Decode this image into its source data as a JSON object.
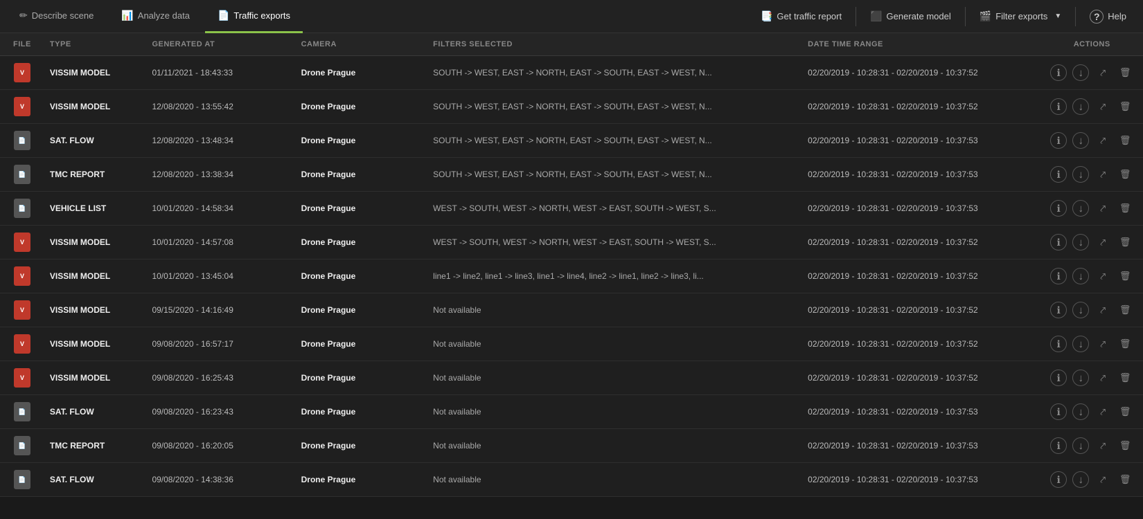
{
  "nav": {
    "tabs": [
      {
        "id": "describe",
        "label": "Describe scene",
        "icon": "pencil",
        "active": false
      },
      {
        "id": "analyze",
        "label": "Analyze data",
        "icon": "chart",
        "active": false
      },
      {
        "id": "traffic-exports",
        "label": "Traffic exports",
        "icon": "export",
        "active": true
      }
    ],
    "actions": [
      {
        "id": "get-traffic",
        "label": "Get traffic report",
        "icon": "traffic"
      },
      {
        "id": "generate-model",
        "label": "Generate model",
        "icon": "model"
      },
      {
        "id": "filter-exports",
        "label": "Filter exports",
        "icon": "filter",
        "dropdown": true
      },
      {
        "id": "help",
        "label": "Help",
        "icon": "help"
      }
    ]
  },
  "table": {
    "columns": [
      {
        "id": "file",
        "label": "FILE"
      },
      {
        "id": "type",
        "label": "TYPE"
      },
      {
        "id": "generated_at",
        "label": "GENERATED AT"
      },
      {
        "id": "camera",
        "label": "CAMERA"
      },
      {
        "id": "filters",
        "label": "FILTERS SELECTED"
      },
      {
        "id": "dtr",
        "label": "DATE TIME RANGE"
      },
      {
        "id": "actions",
        "label": "ACTIONS"
      }
    ],
    "rows": [
      {
        "file_type": "vissim",
        "type": "VISSIM MODEL",
        "generated_at": "01/11/2021 - 18:43:33",
        "camera": "Drone Prague",
        "filters": "SOUTH -> WEST, EAST -> NORTH, EAST -> SOUTH, EAST -> WEST, N...",
        "dtr": "02/20/2019 - 10:28:31 - 02/20/2019 - 10:37:52"
      },
      {
        "file_type": "vissim",
        "type": "VISSIM MODEL",
        "generated_at": "12/08/2020 - 13:55:42",
        "camera": "Drone Prague",
        "filters": "SOUTH -> WEST, EAST -> NORTH, EAST -> SOUTH, EAST -> WEST, N...",
        "dtr": "02/20/2019 - 10:28:31 - 02/20/2019 - 10:37:52"
      },
      {
        "file_type": "sat",
        "type": "SAT. FLOW",
        "generated_at": "12/08/2020 - 13:48:34",
        "camera": "Drone Prague",
        "filters": "SOUTH -> WEST, EAST -> NORTH, EAST -> SOUTH, EAST -> WEST, N...",
        "dtr": "02/20/2019 - 10:28:31 - 02/20/2019 - 10:37:53"
      },
      {
        "file_type": "tmc",
        "type": "TMC REPORT",
        "generated_at": "12/08/2020 - 13:38:34",
        "camera": "Drone Prague",
        "filters": "SOUTH -> WEST, EAST -> NORTH, EAST -> SOUTH, EAST -> WEST, N...",
        "dtr": "02/20/2019 - 10:28:31 - 02/20/2019 - 10:37:53"
      },
      {
        "file_type": "veh",
        "type": "VEHICLE LIST",
        "generated_at": "10/01/2020 - 14:58:34",
        "camera": "Drone Prague",
        "filters": "WEST -> SOUTH, WEST -> NORTH, WEST -> EAST, SOUTH -> WEST, S...",
        "dtr": "02/20/2019 - 10:28:31 - 02/20/2019 - 10:37:53"
      },
      {
        "file_type": "vissim",
        "type": "VISSIM MODEL",
        "generated_at": "10/01/2020 - 14:57:08",
        "camera": "Drone Prague",
        "filters": "WEST -> SOUTH, WEST -> NORTH, WEST -> EAST, SOUTH -> WEST, S...",
        "dtr": "02/20/2019 - 10:28:31 - 02/20/2019 - 10:37:52"
      },
      {
        "file_type": "vissim",
        "type": "VISSIM MODEL",
        "generated_at": "10/01/2020 - 13:45:04",
        "camera": "Drone Prague",
        "filters": "line1 -> line2, line1 -> line3, line1 -> line4, line2 -> line1, line2 -> line3, li...",
        "dtr": "02/20/2019 - 10:28:31 - 02/20/2019 - 10:37:52"
      },
      {
        "file_type": "vissim",
        "type": "VISSIM MODEL",
        "generated_at": "09/15/2020 - 14:16:49",
        "camera": "Drone Prague",
        "filters": "Not available",
        "dtr": "02/20/2019 - 10:28:31 - 02/20/2019 - 10:37:52"
      },
      {
        "file_type": "vissim",
        "type": "VISSIM MODEL",
        "generated_at": "09/08/2020 - 16:57:17",
        "camera": "Drone Prague",
        "filters": "Not available",
        "dtr": "02/20/2019 - 10:28:31 - 02/20/2019 - 10:37:52"
      },
      {
        "file_type": "vissim",
        "type": "VISSIM MODEL",
        "generated_at": "09/08/2020 - 16:25:43",
        "camera": "Drone Prague",
        "filters": "Not available",
        "dtr": "02/20/2019 - 10:28:31 - 02/20/2019 - 10:37:52"
      },
      {
        "file_type": "sat",
        "type": "SAT. FLOW",
        "generated_at": "09/08/2020 - 16:23:43",
        "camera": "Drone Prague",
        "filters": "Not available",
        "dtr": "02/20/2019 - 10:28:31 - 02/20/2019 - 10:37:53"
      },
      {
        "file_type": "tmc",
        "type": "TMC REPORT",
        "generated_at": "09/08/2020 - 16:20:05",
        "camera": "Drone Prague",
        "filters": "Not available",
        "dtr": "02/20/2019 - 10:28:31 - 02/20/2019 - 10:37:53"
      },
      {
        "file_type": "sat",
        "type": "SAT. FLOW",
        "generated_at": "09/08/2020 - 14:38:36",
        "camera": "Drone Prague",
        "filters": "Not available",
        "dtr": "02/20/2019 - 10:28:31 - 02/20/2019 - 10:37:53"
      }
    ]
  }
}
